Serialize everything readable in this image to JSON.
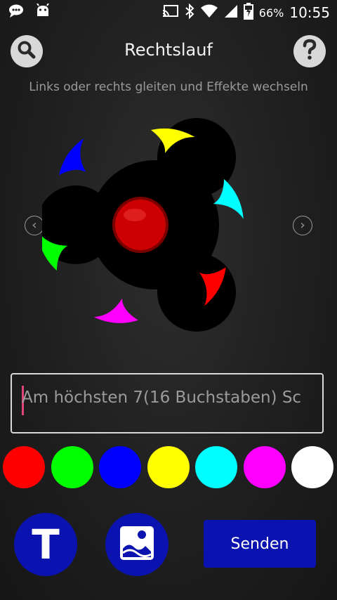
{
  "status_bar": {
    "battery": "66%",
    "time": "10:55",
    "icons": [
      "chat-icon",
      "android-icon",
      "cast-icon",
      "bluetooth-icon",
      "wifi-icon",
      "signal-icon",
      "battery-icon"
    ]
  },
  "header": {
    "title": "Rechtslauf",
    "subtitle": "Links oder rechts gleiten und Effekte wechseln"
  },
  "spinner": {
    "blade_colors": [
      "#ffff00",
      "#00ffff",
      "#ff0000",
      "#ff00ff",
      "#00ff00",
      "#0000ff"
    ],
    "center_color": "#cc0000"
  },
  "nav": {
    "prev": "‹",
    "next": "›"
  },
  "text_input": {
    "placeholder": "Am höchsten 7(16 Buchstaben)  Sc"
  },
  "palette": {
    "colors": [
      "#ff0000",
      "#00ff00",
      "#0000ff",
      "#ffff00",
      "#00ffff",
      "#ff00ff",
      "#ffffff"
    ]
  },
  "actions": {
    "text_button": "T",
    "send_label": "Senden"
  },
  "accent": "#0a13b0"
}
